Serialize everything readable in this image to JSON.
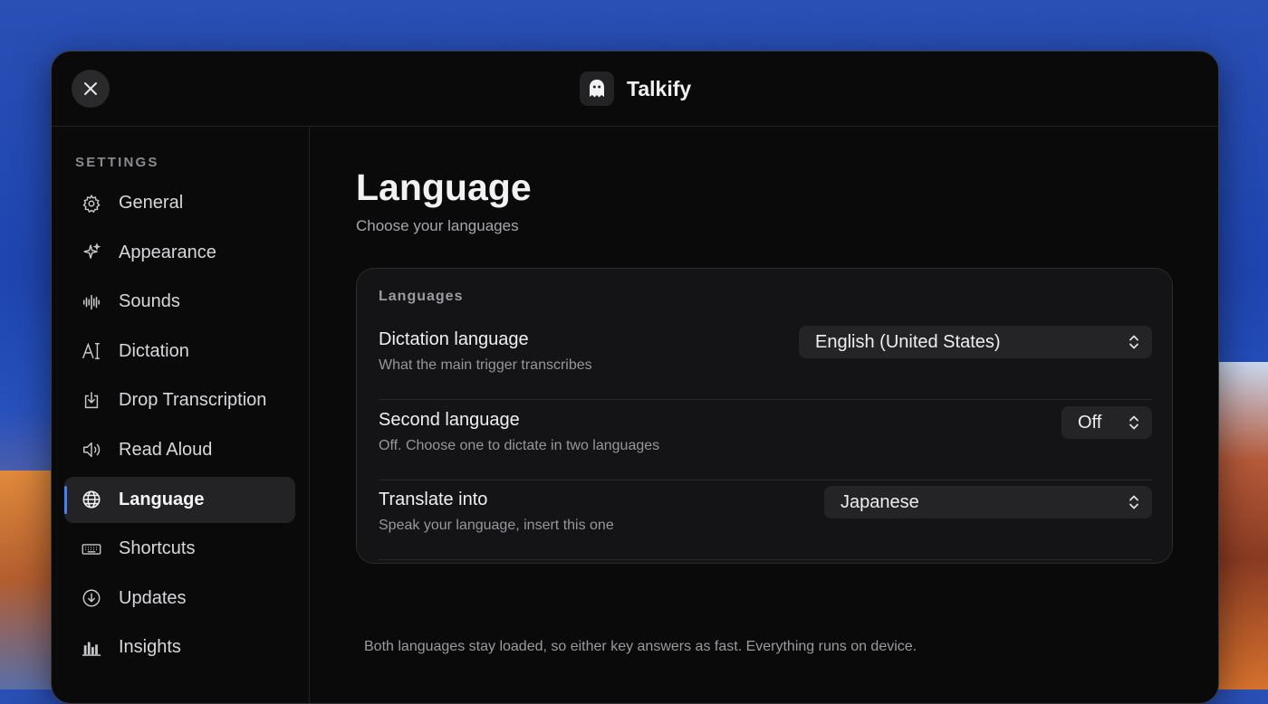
{
  "app": {
    "name": "Talkify"
  },
  "sidebar": {
    "heading": "SETTINGS",
    "items": [
      {
        "label": "General",
        "icon": "gear-icon"
      },
      {
        "label": "Appearance",
        "icon": "sparkle-icon"
      },
      {
        "label": "Sounds",
        "icon": "waveform-icon"
      },
      {
        "label": "Dictation",
        "icon": "text-cursor-icon"
      },
      {
        "label": "Drop Transcription",
        "icon": "tray-download-icon"
      },
      {
        "label": "Read Aloud",
        "icon": "speaker-icon"
      },
      {
        "label": "Language",
        "icon": "globe-icon",
        "active": true
      },
      {
        "label": "Shortcuts",
        "icon": "keyboard-icon"
      },
      {
        "label": "Updates",
        "icon": "download-circle-icon"
      },
      {
        "label": "Insights",
        "icon": "bar-chart-icon"
      }
    ]
  },
  "main": {
    "title": "Language",
    "subtitle": "Choose your languages",
    "card": {
      "heading": "Languages",
      "rows": [
        {
          "title": "Dictation language",
          "description": "What the main trigger transcribes",
          "value": "English (United States)"
        },
        {
          "title": "Second language",
          "description": "Off. Choose one to dictate in two languages",
          "value": "Off"
        },
        {
          "title": "Translate into",
          "description": "Speak your language, insert this one",
          "value": "Japanese"
        }
      ]
    },
    "footer_note": "Both languages stay loaded, so either key answers as fast. Everything runs on device."
  },
  "colors": {
    "accent": "#3d82f7",
    "window_bg": "#0a0a0b",
    "card_bg": "#141416"
  }
}
